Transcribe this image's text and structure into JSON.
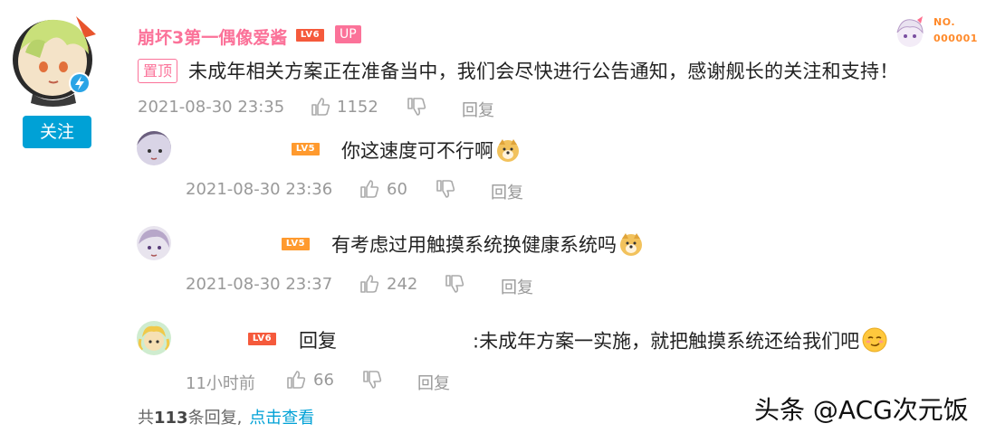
{
  "main_comment": {
    "username": "崩坏3第一偶像爱酱",
    "level": "LV6",
    "up_badge": "UP",
    "follow_label": "关注",
    "pin_label": "置顶",
    "text": "未成年相关方案正在准备当中，我们会尽快进行公告通知，感谢舰长的关注和支持！",
    "time": "2021-08-30 23:35",
    "likes": "1152",
    "reply_label": "回复",
    "nameplate": "NO.\n000001"
  },
  "replies": [
    {
      "level": "LV5",
      "text": "你这速度可不行啊",
      "time": "2021-08-30 23:36",
      "likes": "60",
      "reply_label": "回复",
      "emoji": "doge"
    },
    {
      "level": "LV5",
      "text": "有考虑过用触摸系统换健康系统吗",
      "time": "2021-08-30 23:37",
      "likes": "242",
      "reply_label": "回复",
      "emoji": "doge"
    },
    {
      "level": "LV6",
      "prefix": "回复",
      "text": ":未成年方案一实施，就把触摸系统还给我们吧",
      "time": "11小时前",
      "likes": "66",
      "reply_label": "回复",
      "emoji": "smirk"
    }
  ],
  "footer": {
    "prefix": "共",
    "count": "113",
    "suffix": "条回复,",
    "link": "点击查看"
  },
  "watermark": "头条 @ACG次元饭",
  "colors": {
    "accent_pink": "#fb7299",
    "follow_blue": "#00a1d6",
    "level_red": "#f55a3c",
    "level_orange": "#ff9a2e"
  }
}
